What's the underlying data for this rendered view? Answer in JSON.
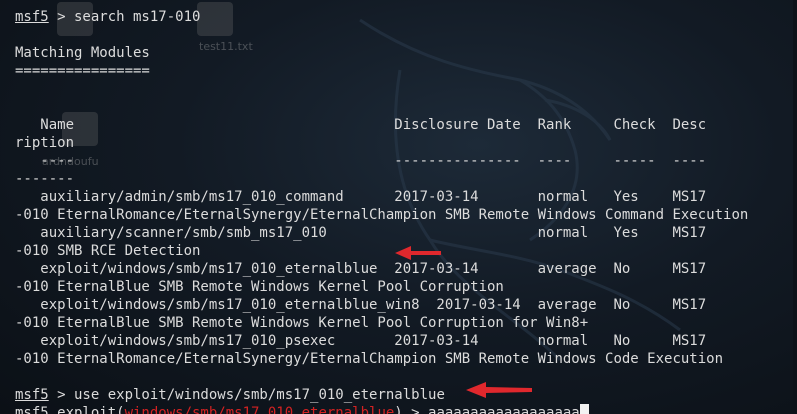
{
  "desktop": {
    "icons": [
      "",
      "test11.txt",
      "",
      "ardndoufu"
    ]
  },
  "terminal": {
    "prompt": "msf5",
    "cmd1": " > search ms17-010",
    "heading": "Matching Modules",
    "underline": "================",
    "header_row": "   Name                                      Disclosure Date  Rank     Check  Desc",
    "header_wrap": "ription",
    "sep_row": "   ----                                      ---------------  ----     -----  ----",
    "sep_wrap": "-------",
    "rows": [
      {
        "main": "   auxiliary/admin/smb/ms17_010_command      2017-03-14       normal   Yes    MS17",
        "wrap": "-010 EternalRomance/EternalSynergy/EternalChampion SMB Remote Windows Command Execution"
      },
      {
        "main": "   auxiliary/scanner/smb/smb_ms17_010                         normal   Yes    MS17",
        "wrap": "-010 SMB RCE Detection"
      },
      {
        "main": "   exploit/windows/smb/ms17_010_eternalblue  2017-03-14       average  No     MS17",
        "wrap": "-010 EternalBlue SMB Remote Windows Kernel Pool Corruption"
      },
      {
        "main": "   exploit/windows/smb/ms17_010_eternalblue_win8  2017-03-14  average  No     MS17",
        "wrap": "-010 EternalBlue SMB Remote Windows Kernel Pool Corruption for Win8+"
      },
      {
        "main": "   exploit/windows/smb/ms17_010_psexec       2017-03-14       normal   No     MS17",
        "wrap": "-010 EternalRomance/EternalSynergy/EternalChampion SMB Remote Windows Code Execution"
      }
    ],
    "cmd2": " > use exploit/windows/smb/ms17_010_eternalblue",
    "prompt2_suffix": " exploit(",
    "module_path": "windows/smb/ms17_010_eternalblue",
    "prompt2_close": ") > ",
    "typed": "aaaaaaaaaaaaaaaaaa"
  },
  "colors": {
    "background": "#0d1219",
    "text": "#dcdcdc",
    "module_red": "#d32222",
    "arrow_red": "#e0282d"
  }
}
